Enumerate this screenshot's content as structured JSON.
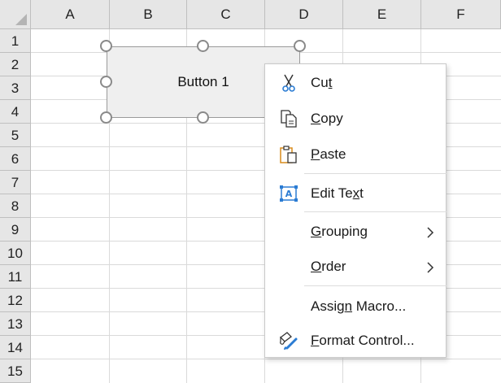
{
  "columns": [
    "A",
    "B",
    "C",
    "D",
    "E",
    "F"
  ],
  "rows": [
    "1",
    "2",
    "3",
    "4",
    "5",
    "6",
    "7",
    "8",
    "9",
    "10",
    "11",
    "12",
    "13",
    "14",
    "15"
  ],
  "form_button": {
    "label": "Button 1"
  },
  "context_menu": {
    "items": [
      {
        "id": "cut",
        "pre": "Cu",
        "key": "t",
        "post": "",
        "icon": "scissors-icon"
      },
      {
        "id": "copy",
        "pre": "",
        "key": "C",
        "post": "opy",
        "icon": "copy-icon"
      },
      {
        "id": "paste",
        "pre": "",
        "key": "P",
        "post": "aste",
        "icon": "paste-icon"
      },
      {
        "id": "edit-text",
        "pre": "Edit Te",
        "key": "x",
        "post": "t",
        "icon": "edit-text-icon"
      },
      {
        "id": "grouping",
        "pre": "",
        "key": "G",
        "post": "rouping",
        "icon": "",
        "submenu": true
      },
      {
        "id": "order",
        "pre": "",
        "key": "O",
        "post": "rder",
        "icon": "",
        "submenu": true
      },
      {
        "id": "assign-macro",
        "pre": "Assig",
        "key": "n",
        "post": " Macro...",
        "icon": ""
      },
      {
        "id": "format-control",
        "pre": "",
        "key": "F",
        "post": "ormat Control...",
        "icon": "format-control-icon"
      }
    ]
  },
  "colors": {
    "header_bg": "#e6e6e6",
    "grid": "#dadada",
    "icon_blue": "#2b7cd3",
    "icon_orange": "#d98b1c"
  }
}
